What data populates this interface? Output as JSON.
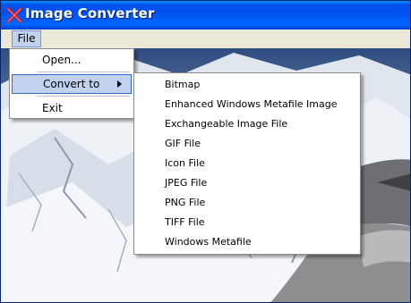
{
  "window": {
    "title": "Image Converter"
  },
  "menubar": {
    "file_label": "File"
  },
  "file_menu": {
    "open_label": "Open...",
    "convert_label": "Convert to",
    "exit_label": "Exit"
  },
  "convert_submenu": {
    "items": [
      {
        "label": "Bitmap"
      },
      {
        "label": "Enhanced Windows Metafile Image"
      },
      {
        "label": "Exchangeable Image File"
      },
      {
        "label": "GIF File"
      },
      {
        "label": "Icon File"
      },
      {
        "label": "JPEG File"
      },
      {
        "label": "PNG File"
      },
      {
        "label": "TIFF File"
      },
      {
        "label": "Windows Metafile"
      }
    ]
  },
  "colors": {
    "titlebar": "#0053ee",
    "menu_highlight": "#c1d2ee",
    "menu_highlight_border": "#316ac5"
  },
  "icons": {
    "app": "red-x-icon",
    "submenu_arrow": "arrow-right-icon"
  }
}
